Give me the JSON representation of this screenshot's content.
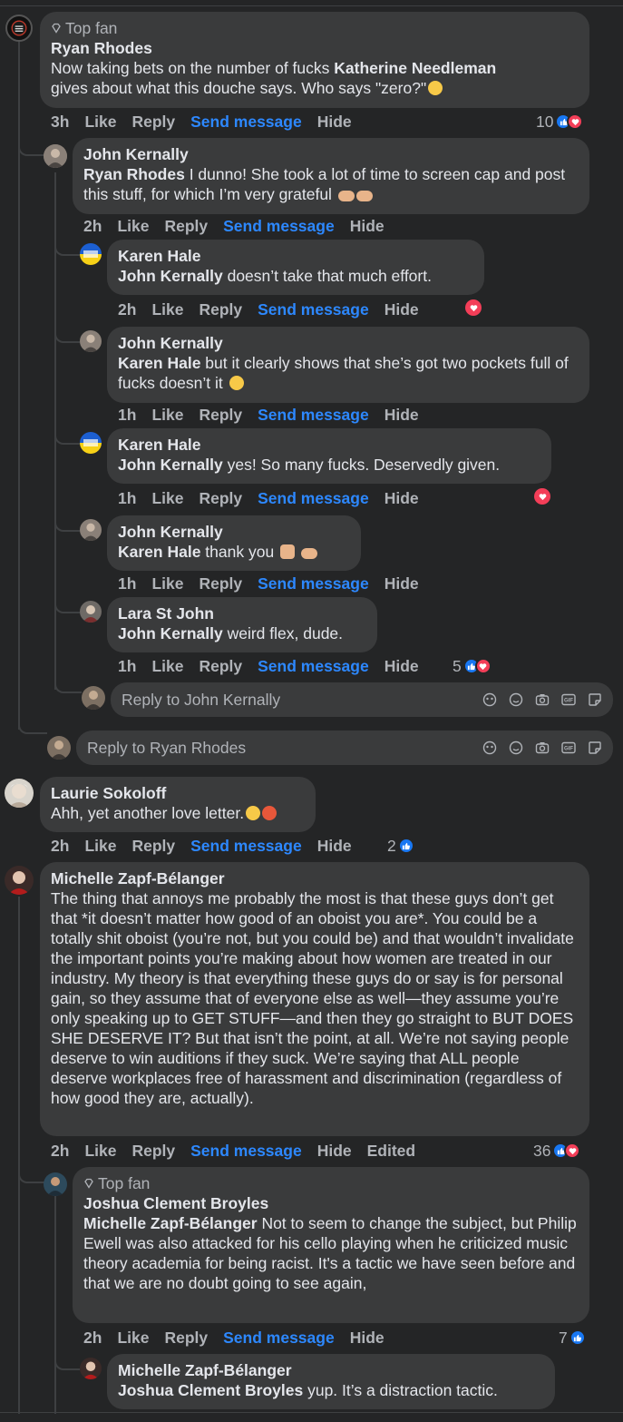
{
  "labels": {
    "like": "Like",
    "reply": "Reply",
    "send_message": "Send message",
    "hide": "Hide",
    "edited": "Edited"
  },
  "comments": [
    {
      "badge": "Top fan",
      "author": "Ryan Rhodes",
      "text_before": "Now taking bets on the number of fucks ",
      "mention": "Katherine Needleman",
      "text_after": "gives about what this douche says. Who says \"zero?\"",
      "time": "3h",
      "reactions": "10"
    },
    {
      "author": "John Kernally",
      "mention": "Ryan Rhodes",
      "text": " I dunno! She took a lot of time to screen cap and post this stuff, for which I’m very grateful",
      "time": "2h"
    },
    {
      "author": "Karen Hale",
      "mention": "John Kernally",
      "text": " doesn’t take that much effort.",
      "time": "2h"
    },
    {
      "author": "John Kernally",
      "mention": "Karen Hale",
      "text": " but it clearly shows that she’s got two pockets full of fucks doesn’t it",
      "time": "1h"
    },
    {
      "author": "Karen Hale",
      "mention": "John Kernally",
      "text": " yes! So many fucks. Deservedly given.",
      "time": "1h"
    },
    {
      "author": "John Kernally",
      "mention": "Karen Hale",
      "text": " thank you",
      "time": "1h"
    },
    {
      "author": "Lara St John",
      "mention": "John Kernally",
      "text": " weird flex, dude.",
      "time": "1h",
      "reactions": "5"
    },
    {
      "author": "Laurie Sokoloff",
      "text": "Ahh, yet another love letter.",
      "time": "2h",
      "reactions": "2"
    },
    {
      "author": "Michelle Zapf-Bélanger",
      "text": "The thing that annoys me probably the most is that these guys don’t get that *it doesn’t matter how good of an oboist you are*. You could be a totally shit oboist (you’re not, but you could be) and that wouldn’t invalidate the important points you’re making about how women are treated in our industry. My theory is that everything these guys do or say is for personal gain, so they assume that of everyone else as well—they assume you’re only speaking up to GET STUFF—and then they go straight to BUT DOES SHE DESERVE IT? But that isn’t the point, at all. We’re not saying people deserve to win auditions if they suck. We’re saying that ALL people deserve workplaces free of harassment and discrimination (regardless of how good they are, actually).",
      "time": "2h",
      "reactions": "36"
    },
    {
      "badge": "Top fan",
      "author": "Joshua Clement Broyles",
      "mention": "Michelle Zapf-Bélanger",
      "text": " Not to seem to change the subject, but Philip Ewell was also attacked for his cello playing when he criticized music theory academia for being racist. It's a tactic we have seen before and that we are no doubt going to see again,",
      "time": "2h",
      "reactions": "7"
    },
    {
      "author": "Michelle Zapf-Bélanger",
      "mention": "Joshua Clement Broyles",
      "text": " yup. It’s a distraction tactic."
    }
  ],
  "reply_boxes": {
    "john": "Reply to John Kernally",
    "ryan": "Reply to Ryan Rhodes"
  },
  "colors": {
    "background": "#242526",
    "bubble": "#3a3b3c",
    "link": "#2d88ff",
    "like": "#1877f2",
    "love": "#f33e58"
  }
}
